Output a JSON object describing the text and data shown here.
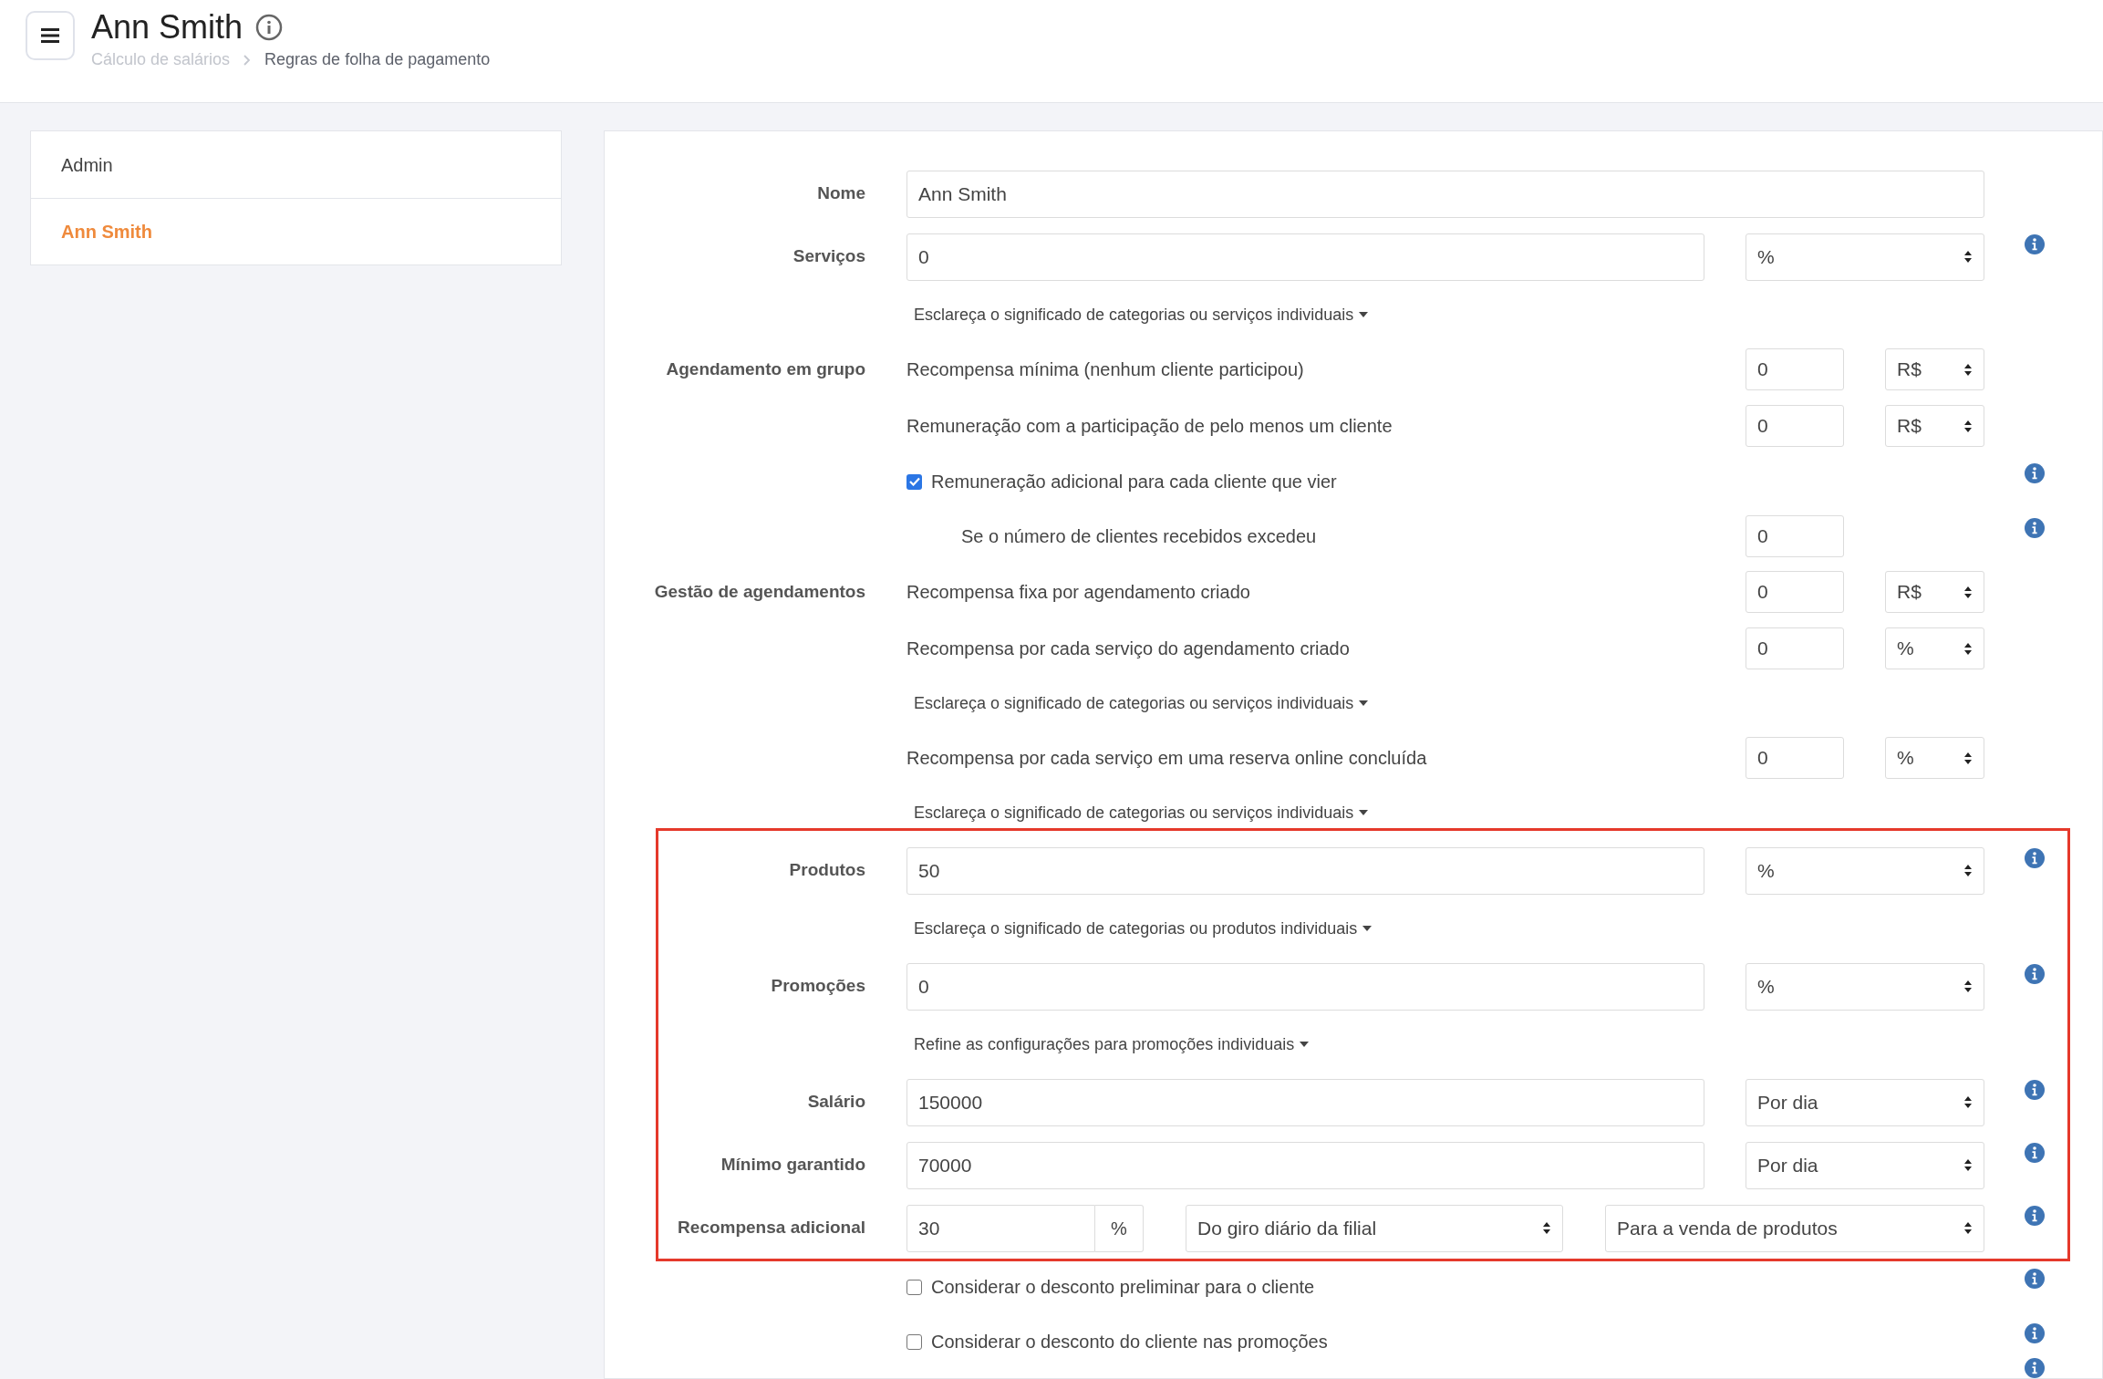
{
  "header": {
    "title": "Ann Smith",
    "breadcrumb": [
      "Cálculo de salários",
      "Regras de folha de pagamento"
    ]
  },
  "sidebar": {
    "items": [
      {
        "label": "Admin",
        "selected": false
      },
      {
        "label": "Ann Smith",
        "selected": true
      }
    ]
  },
  "sections": [
    {
      "highlighted": false,
      "rows": [
        {
          "kind": "text_input",
          "label": "Nome",
          "value": "Ann Smith",
          "info": false
        },
        {
          "kind": "input_select",
          "label": "Serviços",
          "value": "0",
          "select": "%",
          "info": true
        },
        {
          "kind": "link",
          "text": "Esclareça o significado de categorias ou serviços individuais"
        },
        {
          "kind": "sub_input_select",
          "label": "Agendamento em grupo",
          "text": "Recompensa mínima (nenhum cliente participou)",
          "value": "0",
          "select": "R$",
          "info": false
        },
        {
          "kind": "sub_input_select",
          "text": "Remuneração com a participação de pelo menos um cliente",
          "value": "0",
          "select": "R$",
          "info": false
        },
        {
          "kind": "checkbox",
          "text": "Remuneração adicional para cada cliente que vier",
          "checked": true,
          "info": true
        },
        {
          "kind": "sub_input",
          "text": "Se o número de clientes recebidos excedeu",
          "value": "0",
          "info": true
        },
        {
          "kind": "sub_input_select",
          "label": "Gestão de agendamentos",
          "text": "Recompensa fixa por agendamento criado",
          "value": "0",
          "select": "R$",
          "info": false
        },
        {
          "kind": "sub_input_select",
          "text": "Recompensa por cada serviço do agendamento criado",
          "value": "0",
          "select": "%",
          "info": false
        },
        {
          "kind": "link",
          "text": "Esclareça o significado de categorias ou serviços individuais"
        },
        {
          "kind": "sub_input_select",
          "text": "Recompensa por cada serviço em uma reserva online concluída",
          "value": "0",
          "select": "%",
          "info": false
        },
        {
          "kind": "link",
          "text": "Esclareça o significado de categorias ou serviços individuais"
        }
      ]
    },
    {
      "highlighted": true,
      "rows": [
        {
          "kind": "input_select",
          "label": "Produtos",
          "value": "50",
          "select": "%",
          "info": true
        },
        {
          "kind": "link",
          "text": "Esclareça o significado de categorias ou produtos individuais"
        },
        {
          "kind": "input_select",
          "label": "Promoções",
          "value": "0",
          "select": "%",
          "info": true
        },
        {
          "kind": "link",
          "text": "Refine as configurações para promoções individuais"
        },
        {
          "kind": "input_select",
          "label": "Salário",
          "value": "150000",
          "select": "Por dia",
          "info": true
        },
        {
          "kind": "input_select",
          "label": "Mínimo garantido",
          "value": "70000",
          "select": "Por dia",
          "info": true
        },
        {
          "kind": "triple",
          "label": "Recompensa adicional",
          "value": "30",
          "addon": "%",
          "select": "Do giro diário da filial",
          "select2": "Para a venda de produtos",
          "info": true
        }
      ]
    },
    {
      "highlighted": false,
      "rows": [
        {
          "kind": "checkbox",
          "text": "Considerar o desconto preliminar para o cliente",
          "checked": false,
          "info": true
        },
        {
          "kind": "checkbox",
          "text": "Considerar o desconto do cliente nas promoções",
          "checked": false,
          "info": true
        },
        {
          "kind": "blank",
          "info": true
        }
      ]
    }
  ]
}
